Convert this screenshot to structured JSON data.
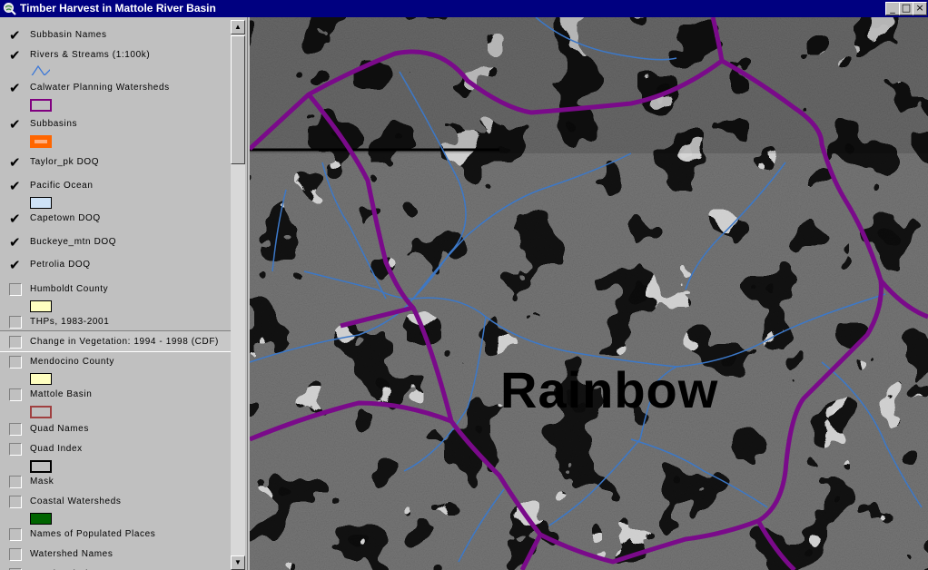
{
  "window": {
    "title": "Timber Harvest in Mattole River Basin",
    "icon": "arcview-globe-icon",
    "controls": [
      "_",
      "□",
      "×"
    ]
  },
  "legend": {
    "items": [
      {
        "label": "Subbasin Names",
        "checked": true,
        "symbol": "none"
      },
      {
        "label": "Rivers & Streams (1:100k)",
        "checked": true,
        "symbol": "line",
        "color": "#3c78d8"
      },
      {
        "label": "Calwater Planning Watersheds",
        "checked": true,
        "symbol": "outline",
        "color": "#800080"
      },
      {
        "label": "Subbasins",
        "checked": true,
        "symbol": "outline",
        "color": "#ff6600"
      },
      {
        "label": "Taylor_pk DOQ",
        "checked": true,
        "symbol": "none"
      },
      {
        "label": "Pacific Ocean",
        "checked": true,
        "symbol": "fill",
        "color": "#cfe3f7"
      },
      {
        "label": "Capetown DOQ",
        "checked": true,
        "symbol": "none"
      },
      {
        "label": "Buckeye_mtn DOQ",
        "checked": true,
        "symbol": "none"
      },
      {
        "label": "Petrolia DOQ",
        "checked": true,
        "symbol": "none"
      },
      {
        "label": "Humboldt County",
        "checked": false,
        "symbol": "fill",
        "color": "#ffffc0"
      },
      {
        "label": "THPs, 1983-2001",
        "checked": false,
        "symbol": "none"
      },
      {
        "label": "Change in Vegetation: 1994 - 1998 (CDF)",
        "checked": false,
        "symbol": "none",
        "selected": true
      },
      {
        "label": "Mendocino County",
        "checked": false,
        "symbol": "fill",
        "color": "#ffffc0"
      },
      {
        "label": "Mattole Basin",
        "checked": false,
        "symbol": "outline",
        "color": "#a04040"
      },
      {
        "label": "Quad Names",
        "checked": false,
        "symbol": "none"
      },
      {
        "label": "Quad Index",
        "checked": false,
        "symbol": "outline",
        "color": "#000000"
      },
      {
        "label": "Mask",
        "checked": false,
        "symbol": "none"
      },
      {
        "label": "Coastal Watersheds",
        "checked": false,
        "symbol": "fill",
        "color": "#006400"
      },
      {
        "label": "Names of Populated Places",
        "checked": false,
        "symbol": "none"
      },
      {
        "label": "Watershed Names",
        "checked": false,
        "symbol": "none"
      },
      {
        "label": "Populated Places",
        "checked": false,
        "symbol": "none"
      }
    ]
  },
  "map": {
    "label": "Rainbow",
    "watershed_color": "#7a0a8a",
    "stream_color": "#3c78c8"
  }
}
